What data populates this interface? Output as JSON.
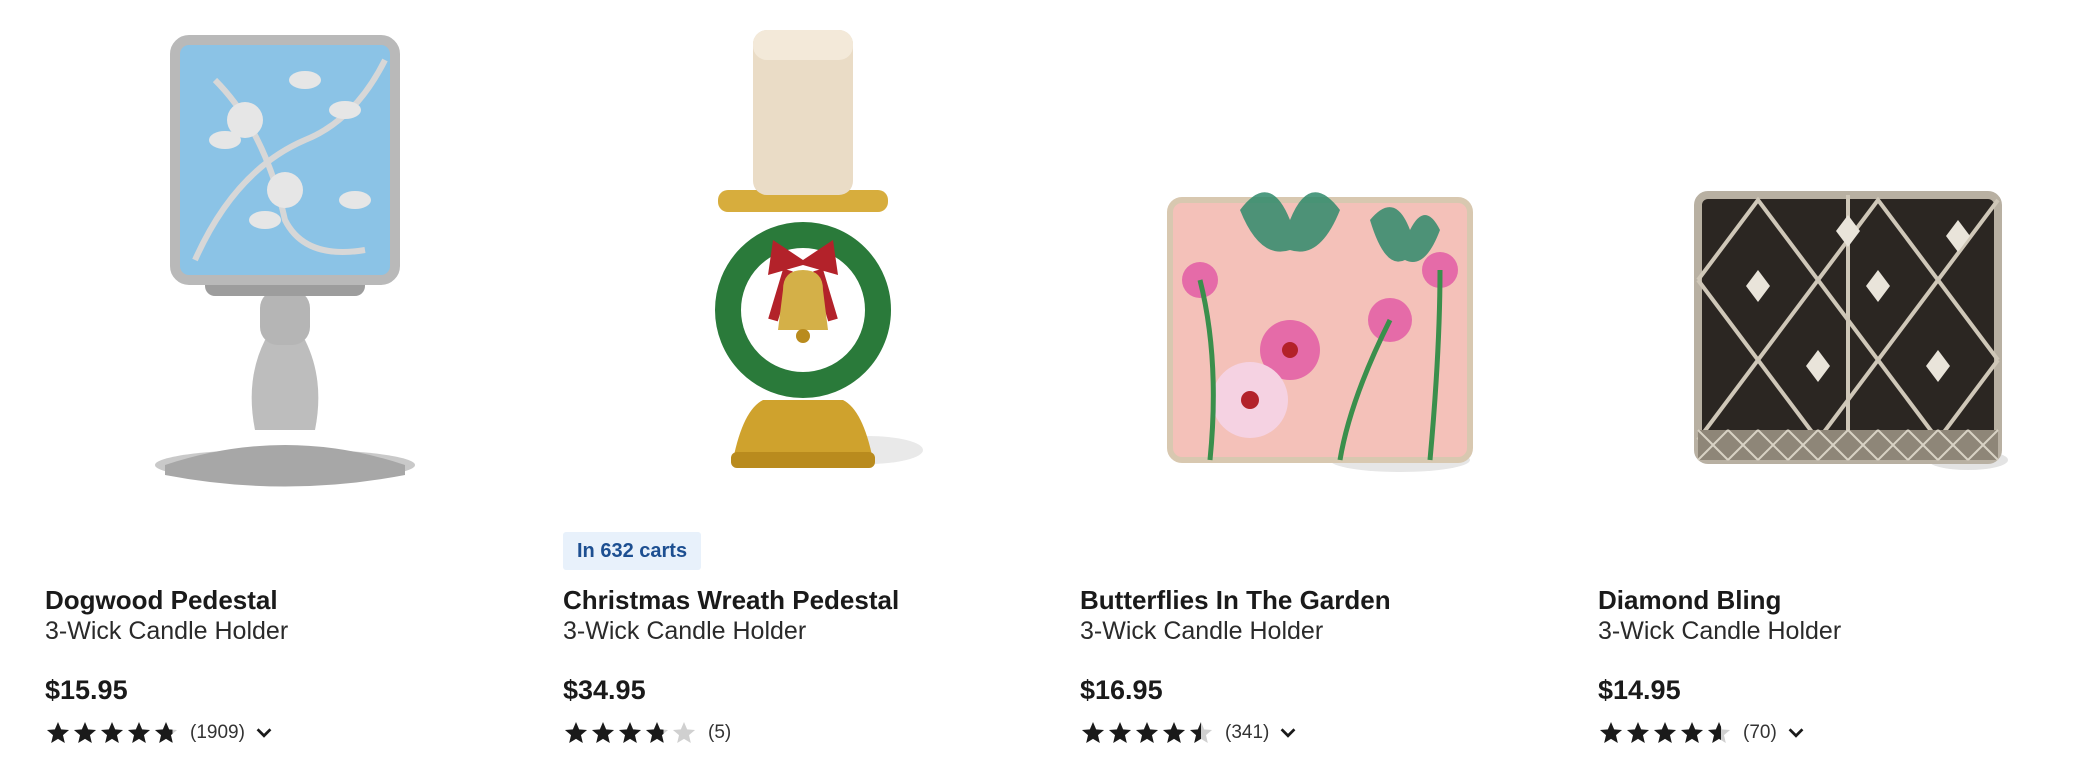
{
  "products": [
    {
      "name": "Dogwood Pedestal",
      "subtitle": "3-Wick Candle Holder",
      "price": "$15.95",
      "rating": 4.8,
      "review_count": "(1909)",
      "badge": "",
      "has_reviews_toggle": true,
      "image_icon": "dogwood-pedestal-holder"
    },
    {
      "name": "Christmas Wreath Pedestal",
      "subtitle": "3-Wick Candle Holder",
      "price": "$34.95",
      "rating": 3.8,
      "review_count": "(5)",
      "badge": "In 632 carts",
      "has_reviews_toggle": false,
      "image_icon": "christmas-wreath-pedestal-holder"
    },
    {
      "name": "Butterflies In The Garden",
      "subtitle": "3-Wick Candle Holder",
      "price": "$16.95",
      "rating": 4.5,
      "review_count": "(341)",
      "badge": "",
      "has_reviews_toggle": true,
      "image_icon": "butterfly-garden-sleeve"
    },
    {
      "name": "Diamond Bling",
      "subtitle": "3-Wick Candle Holder",
      "price": "$14.95",
      "rating": 4.6,
      "review_count": "(70)",
      "badge": "",
      "has_reviews_toggle": true,
      "image_icon": "diamond-bling-sleeve"
    }
  ],
  "colors": {
    "badge_bg": "#e8f1fb",
    "badge_text": "#1d4f91",
    "star_filled": "#1a1a1a",
    "star_empty": "#d0d0d0"
  }
}
